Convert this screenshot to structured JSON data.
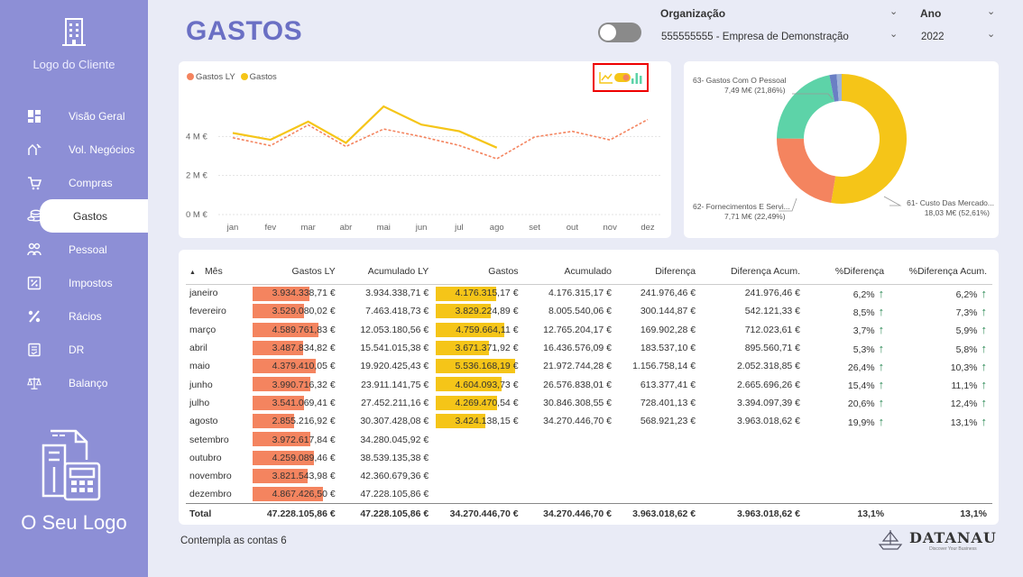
{
  "sidebar": {
    "client_logo_label": "Logo do Cliente",
    "your_logo_label": "O Seu Logo",
    "items": [
      {
        "label": "Visão Geral",
        "icon": "dashboard-icon"
      },
      {
        "label": "Vol. Negócios",
        "icon": "handshake-icon"
      },
      {
        "label": "Compras",
        "icon": "cart-icon"
      },
      {
        "label": "Gastos",
        "icon": "coins-icon",
        "active": true
      },
      {
        "label": "Pessoal",
        "icon": "people-icon"
      },
      {
        "label": "Impostos",
        "icon": "percent-doc-icon"
      },
      {
        "label": "Rácios",
        "icon": "percent-icon"
      },
      {
        "label": "DR",
        "icon": "report-icon"
      },
      {
        "label": "Balanço",
        "icon": "scale-icon"
      }
    ]
  },
  "header": {
    "title": "GASTOS",
    "org_label": "Organização",
    "org_value": "555555555 - Empresa de Demonstração",
    "year_label": "Ano",
    "year_value": "2022"
  },
  "colors": {
    "gastos_ly": "#f4845f",
    "gastos": "#f5c518",
    "donut_teal": "#5dd3a8",
    "sidebar": "#8d8fd6",
    "title": "#6a6fc4"
  },
  "chart_data": [
    {
      "type": "line",
      "legend": [
        "Gastos LY",
        "Gastos"
      ],
      "x": [
        "jan",
        "fev",
        "mar",
        "abr",
        "mai",
        "jun",
        "jul",
        "ago",
        "set",
        "out",
        "nov",
        "dez"
      ],
      "yticks": [
        "0 M €",
        "2 M €",
        "4 M €"
      ],
      "ylim": [
        0,
        6000000
      ],
      "series": [
        {
          "name": "Gastos LY",
          "values": [
            3934338.71,
            3529080.02,
            4589761.83,
            3487834.82,
            4379410.05,
            3990716.32,
            3541069.41,
            2855216.92,
            3972617.84,
            4259089.46,
            3821543.98,
            4867426.5
          ]
        },
        {
          "name": "Gastos",
          "values": [
            4176315.17,
            3829224.89,
            4759664.11,
            3671371.92,
            5536168.19,
            4604093.73,
            4269470.54,
            3424138.15,
            null,
            null,
            null,
            null
          ]
        }
      ]
    },
    {
      "type": "pie",
      "slices": [
        {
          "label": "61- Custo Das Mercado...",
          "value_label": "18,03 M€ (52,61%)",
          "percent": 52.61,
          "color": "#f5c518"
        },
        {
          "label": "62- Fornecimentos E Servi...",
          "value_label": "7,71 M€ (22,49%)",
          "percent": 22.49,
          "color": "#f4845f"
        },
        {
          "label": "63- Gastos Com O Pessoal",
          "value_label": "7,49 M€ (21,86%)",
          "percent": 21.86,
          "color": "#5dd3a8"
        },
        {
          "label": "",
          "value_label": "",
          "percent": 1.8,
          "color": "#6a7fc4"
        },
        {
          "label": "",
          "value_label": "",
          "percent": 1.24,
          "color": "#9fb3d9"
        }
      ]
    }
  ],
  "table": {
    "headers": [
      "Mês",
      "Gastos LY",
      "Acumulado LY",
      "Gastos",
      "Acumulado",
      "Diferença",
      "Diferença Acum.",
      "%Diferença",
      "%Diferença Acum."
    ],
    "max_bar": 5536168.19,
    "rows": [
      {
        "mes": "janeiro",
        "gly": "3.934.338,71 €",
        "gly_v": 3934338.71,
        "aly": "3.934.338,71 €",
        "g": "4.176.315,17 €",
        "g_v": 4176315.17,
        "ac": "4.176.315,17 €",
        "dif": "241.976,46 €",
        "difa": "241.976,46 €",
        "pd": "6,2%",
        "pda": "6,2%"
      },
      {
        "mes": "fevereiro",
        "gly": "3.529.080,02 €",
        "gly_v": 3529080.02,
        "aly": "7.463.418,73 €",
        "g": "3.829.224,89 €",
        "g_v": 3829224.89,
        "ac": "8.005.540,06 €",
        "dif": "300.144,87 €",
        "difa": "542.121,33 €",
        "pd": "8,5%",
        "pda": "7,3%"
      },
      {
        "mes": "março",
        "gly": "4.589.761,83 €",
        "gly_v": 4589761.83,
        "aly": "12.053.180,56 €",
        "g": "4.759.664,11 €",
        "g_v": 4759664.11,
        "ac": "12.765.204,17 €",
        "dif": "169.902,28 €",
        "difa": "712.023,61 €",
        "pd": "3,7%",
        "pda": "5,9%"
      },
      {
        "mes": "abril",
        "gly": "3.487.834,82 €",
        "gly_v": 3487834.82,
        "aly": "15.541.015,38 €",
        "g": "3.671.371,92 €",
        "g_v": 3671371.92,
        "ac": "16.436.576,09 €",
        "dif": "183.537,10 €",
        "difa": "895.560,71 €",
        "pd": "5,3%",
        "pda": "5,8%"
      },
      {
        "mes": "maio",
        "gly": "4.379.410,05 €",
        "gly_v": 4379410.05,
        "aly": "19.920.425,43 €",
        "g": "5.536.168,19 €",
        "g_v": 5536168.19,
        "ac": "21.972.744,28 €",
        "dif": "1.156.758,14 €",
        "difa": "2.052.318,85 €",
        "pd": "26,4%",
        "pda": "10,3%"
      },
      {
        "mes": "junho",
        "gly": "3.990.716,32 €",
        "gly_v": 3990716.32,
        "aly": "23.911.141,75 €",
        "g": "4.604.093,73 €",
        "g_v": 4604093.73,
        "ac": "26.576.838,01 €",
        "dif": "613.377,41 €",
        "difa": "2.665.696,26 €",
        "pd": "15,4%",
        "pda": "11,1%"
      },
      {
        "mes": "julho",
        "gly": "3.541.069,41 €",
        "gly_v": 3541069.41,
        "aly": "27.452.211,16 €",
        "g": "4.269.470,54 €",
        "g_v": 4269470.54,
        "ac": "30.846.308,55 €",
        "dif": "728.401,13 €",
        "difa": "3.394.097,39 €",
        "pd": "20,6%",
        "pda": "12,4%"
      },
      {
        "mes": "agosto",
        "gly": "2.855.216,92 €",
        "gly_v": 2855216.92,
        "aly": "30.307.428,08 €",
        "g": "3.424.138,15 €",
        "g_v": 3424138.15,
        "ac": "34.270.446,70 €",
        "dif": "568.921,23 €",
        "difa": "3.963.018,62 €",
        "pd": "19,9%",
        "pda": "13,1%"
      },
      {
        "mes": "setembro",
        "gly": "3.972.617,84 €",
        "gly_v": 3972617.84,
        "aly": "34.280.045,92 €",
        "g": "",
        "g_v": 0,
        "ac": "",
        "dif": "",
        "difa": "",
        "pd": "",
        "pda": ""
      },
      {
        "mes": "outubro",
        "gly": "4.259.089,46 €",
        "gly_v": 4259089.46,
        "aly": "38.539.135,38 €",
        "g": "",
        "g_v": 0,
        "ac": "",
        "dif": "",
        "difa": "",
        "pd": "",
        "pda": ""
      },
      {
        "mes": "novembro",
        "gly": "3.821.543,98 €",
        "gly_v": 3821543.98,
        "aly": "42.360.679,36 €",
        "g": "",
        "g_v": 0,
        "ac": "",
        "dif": "",
        "difa": "",
        "pd": "",
        "pda": ""
      },
      {
        "mes": "dezembro",
        "gly": "4.867.426,50 €",
        "gly_v": 4867426.5,
        "aly": "47.228.105,86 €",
        "g": "",
        "g_v": 0,
        "ac": "",
        "dif": "",
        "difa": "",
        "pd": "",
        "pda": ""
      }
    ],
    "total": {
      "mes": "Total",
      "gly": "47.228.105,86 €",
      "aly": "47.228.105,86 €",
      "g": "34.270.446,70 €",
      "ac": "34.270.446,70 €",
      "dif": "3.963.018,62 €",
      "difa": "3.963.018,62 €",
      "pd": "13,1%",
      "pda": "13,1%"
    }
  },
  "footnote": "Contempla as contas 6",
  "brand": {
    "name": "DATANAU",
    "tagline": "Discover Your Business"
  }
}
